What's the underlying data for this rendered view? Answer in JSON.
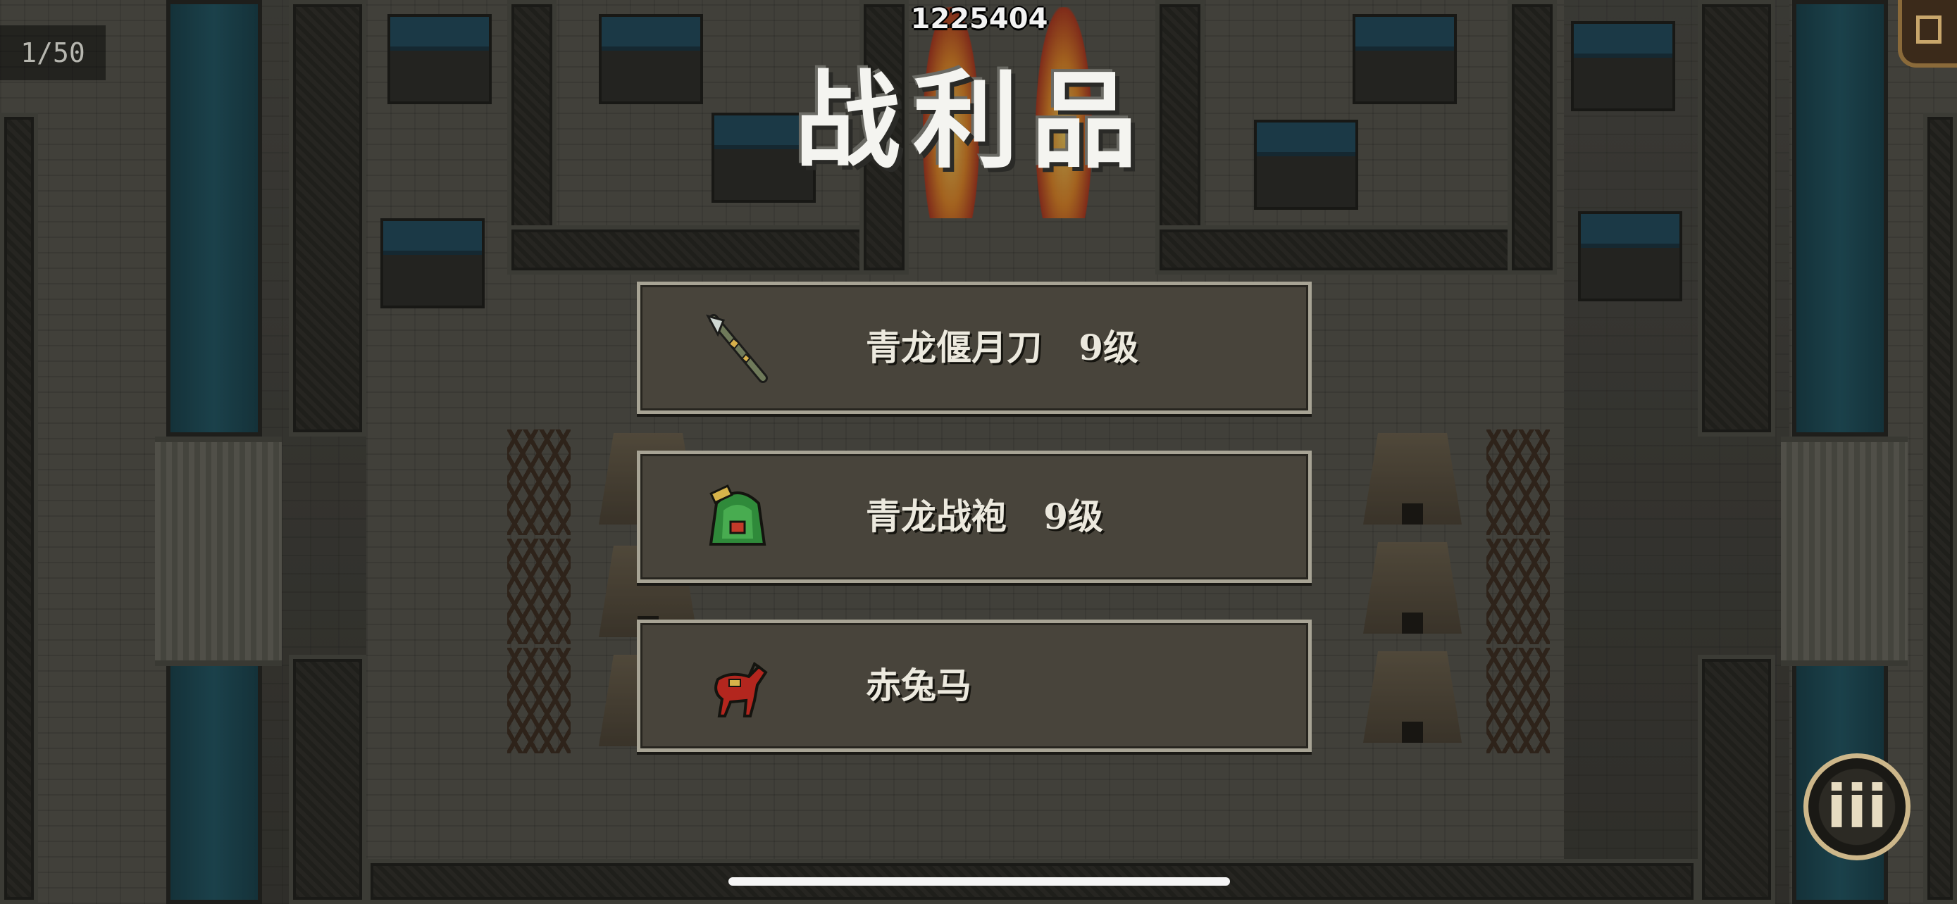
{
  "hud": {
    "score": "1225404",
    "counter": "1/50"
  },
  "dialog": {
    "title": "战利品",
    "items": [
      {
        "name": "青龙偃月刀   9级",
        "icon": "blade-icon"
      },
      {
        "name": "青龙战袍   9级",
        "icon": "armor-robe-icon"
      },
      {
        "name": "赤兔马",
        "icon": "red-horse-icon"
      }
    ]
  },
  "controls": {
    "round_button_glyph": "iii",
    "menu_icon": "scroll-menu-icon"
  },
  "colors": {
    "panel_bg": "#48443b",
    "panel_border": "#a8a495",
    "title": "#f4f4f0",
    "button_ring": "#cdb78a"
  }
}
